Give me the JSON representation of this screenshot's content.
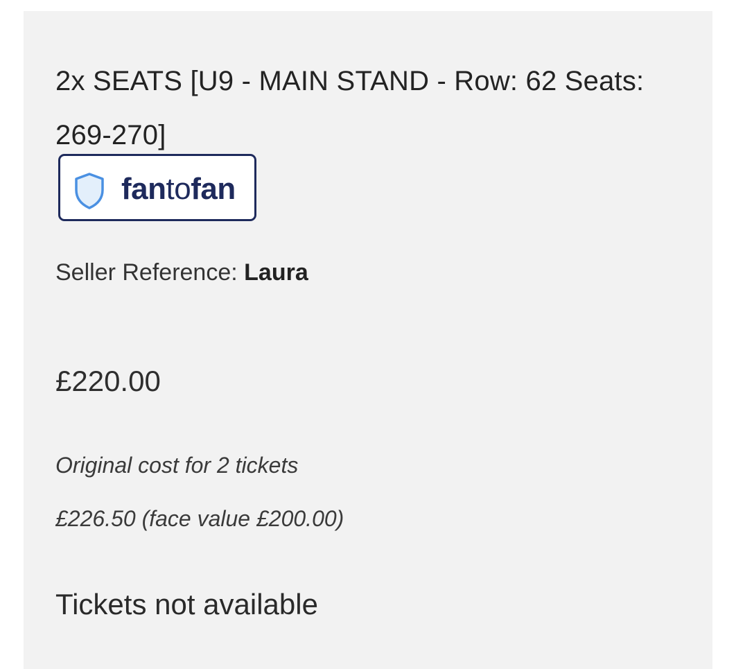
{
  "listing": {
    "title": "2x SEATS [U9 - MAIN STAND - Row: 62 Seats: 269-270]",
    "badge": {
      "icon": "shield-icon",
      "brand_part1": "fan",
      "brand_part2": "to",
      "brand_part3": "fan",
      "brand_color": "#1e2a5c",
      "icon_color": "#4a90e2"
    },
    "seller_reference_label": "Seller Reference: ",
    "seller_reference_value": "Laura",
    "price": "£220.00",
    "original_cost_label": "Original cost for 2 tickets",
    "original_cost_value": "£226.50 (face value £200.00)",
    "availability": "Tickets not available"
  }
}
